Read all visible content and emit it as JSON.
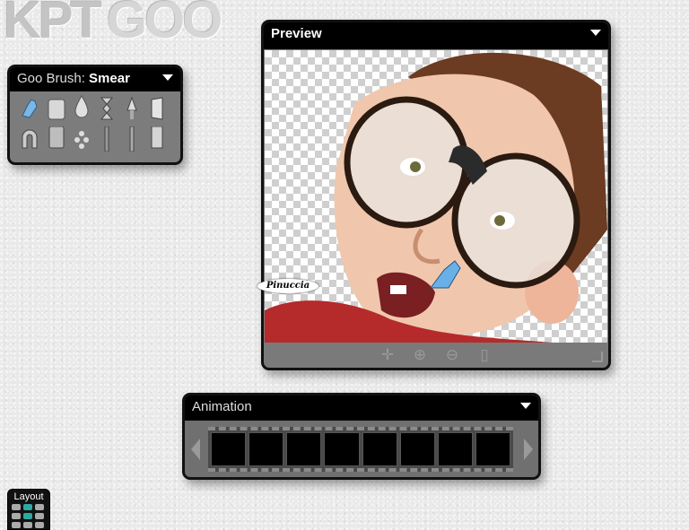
{
  "logo": {
    "part1": "KPT",
    "part2": "GOO"
  },
  "brush_panel": {
    "title_prefix": "Goo Brush:",
    "title_value": "Smear",
    "tools": [
      "smear-glove-icon",
      "eraser-icon",
      "drop-icon",
      "twirl-icon",
      "brush-icon",
      "layer-icon",
      "magnet-icon",
      "smudge-icon",
      "spray-icon",
      "knife-icon",
      "rake-icon",
      "cone-icon"
    ]
  },
  "preview_panel": {
    "title": "Preview",
    "tools": [
      "move-icon",
      "zoom-in-icon",
      "zoom-out-icon",
      "page-icon"
    ]
  },
  "signature": {
    "text": "Pinuccia"
  },
  "animation_panel": {
    "title": "Animation",
    "frame_count": 8
  },
  "layout_widget": {
    "label": "Layout"
  },
  "colors": {
    "accent": "#2fa89f",
    "panel_bg": "#7c7c7c",
    "header_bg": "#000000"
  }
}
